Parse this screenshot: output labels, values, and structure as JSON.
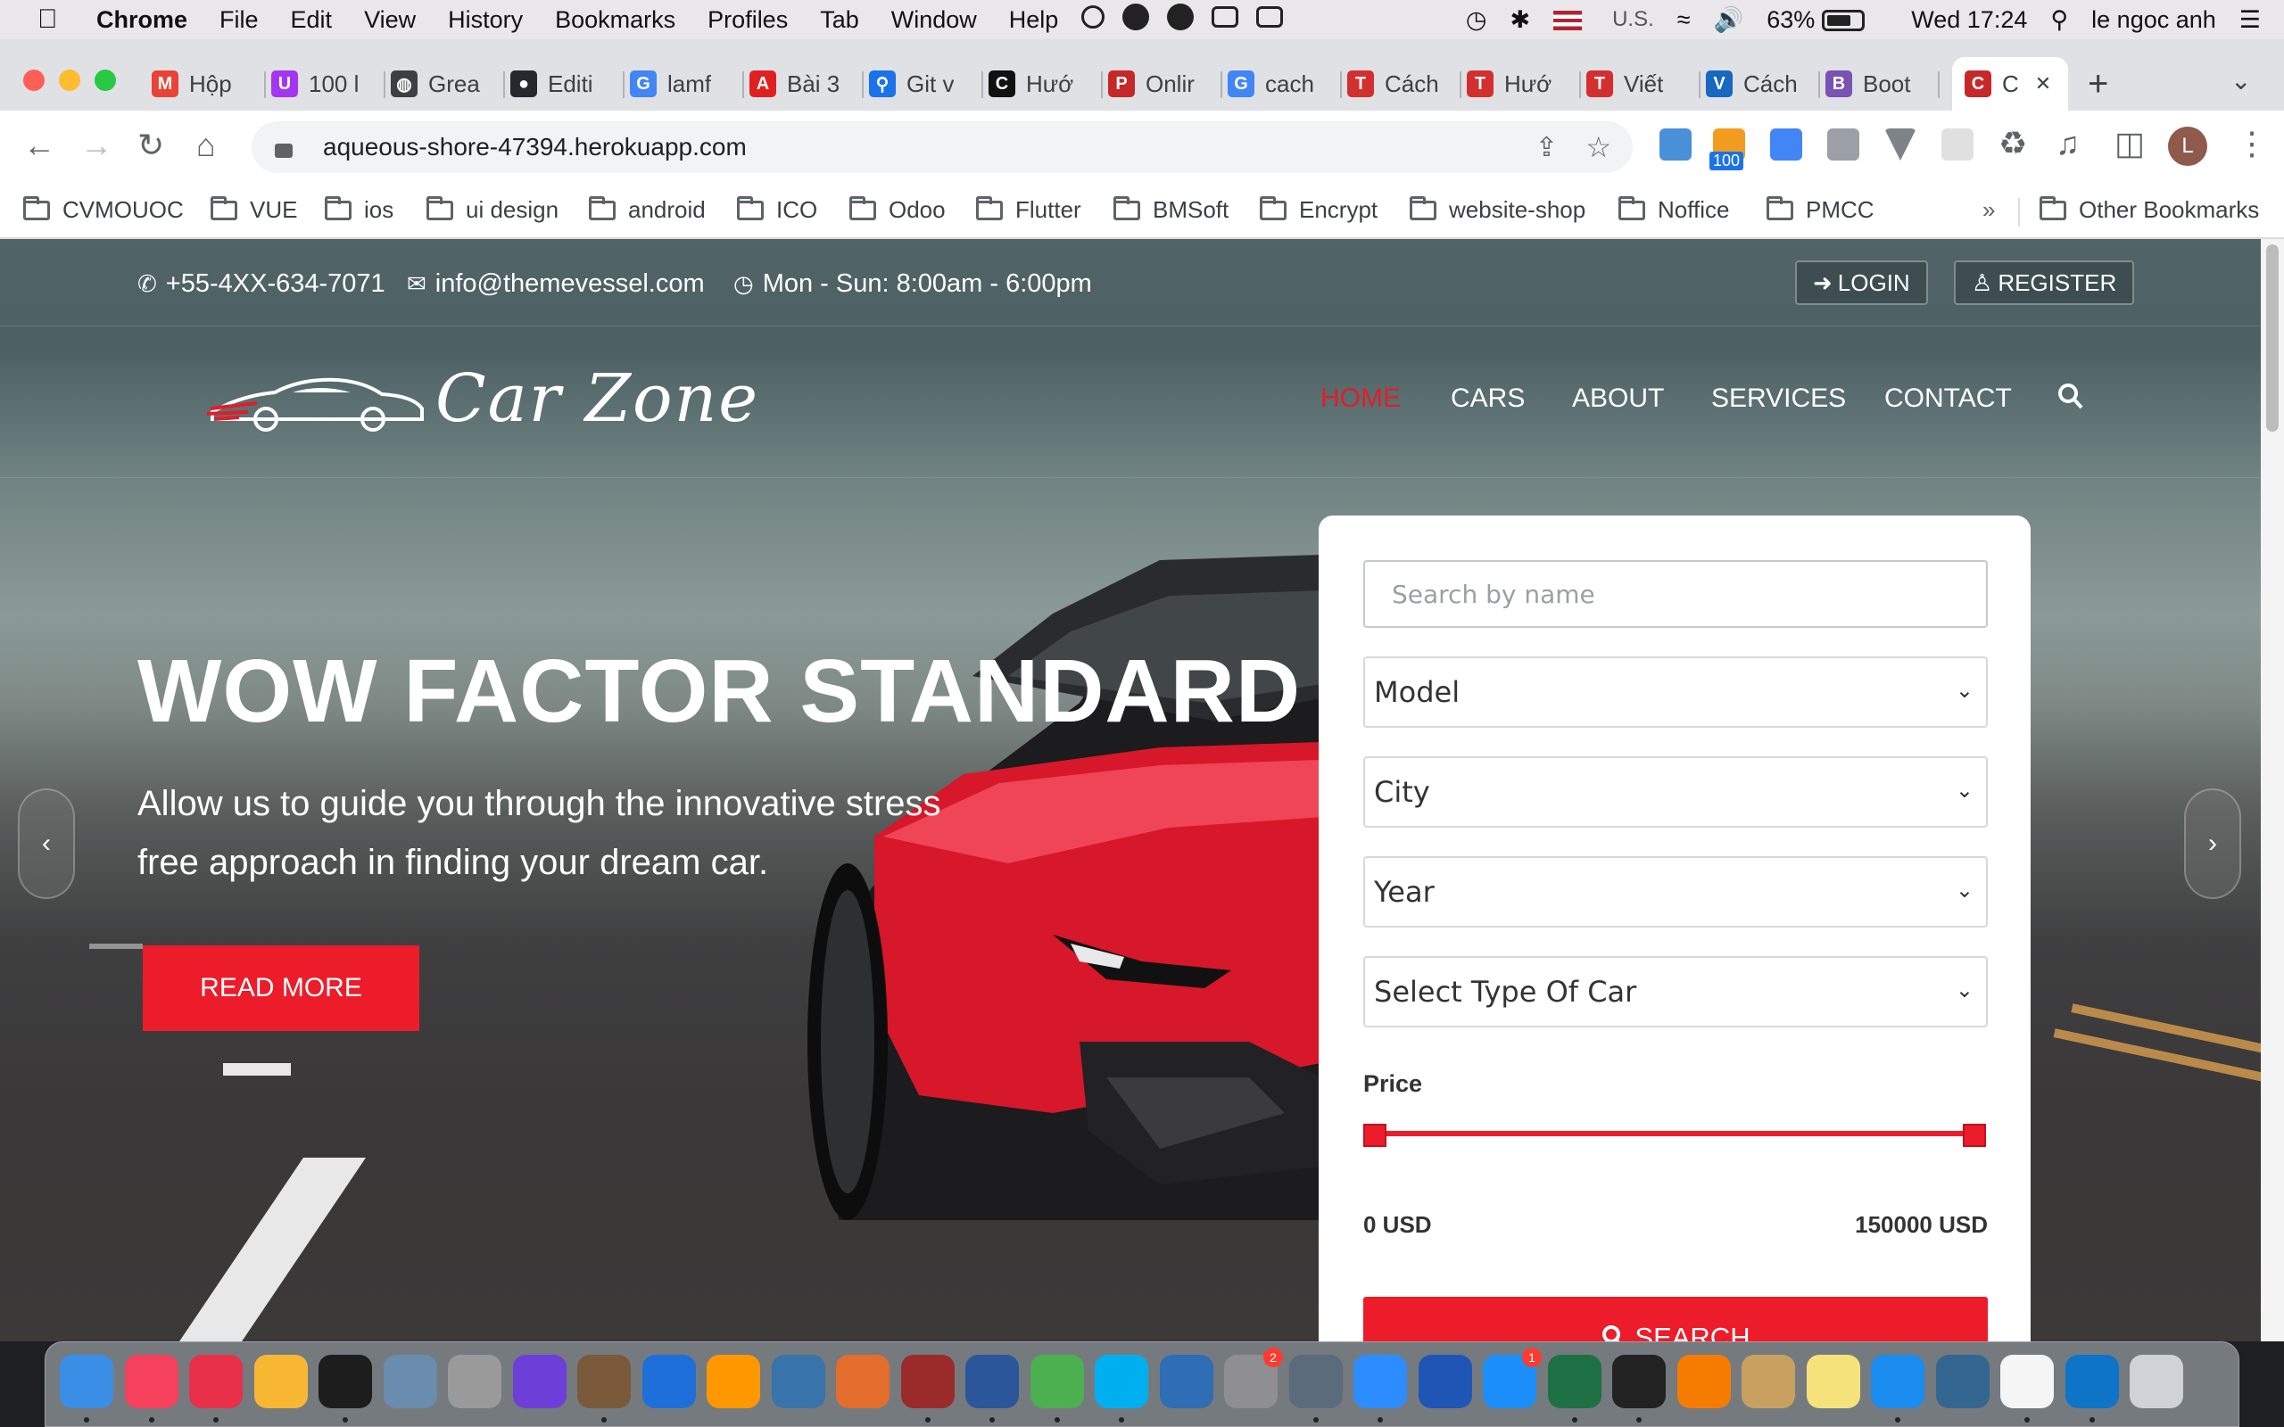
{
  "menubar": {
    "app": "Chrome",
    "items": [
      "File",
      "Edit",
      "View",
      "History",
      "Bookmarks",
      "Profiles",
      "Tab",
      "Window",
      "Help"
    ],
    "input_source": "U.S.",
    "battery": "63%",
    "clock": "Wed 17:24",
    "user": "le ngoc anh"
  },
  "tabs": [
    {
      "title": "Hộp",
      "icon": "gmail-icon",
      "color": "#ea4335",
      "glyph": "M"
    },
    {
      "title": "100 l",
      "icon": "udemy-icon",
      "color": "#a435f0",
      "glyph": "U"
    },
    {
      "title": "Grea",
      "icon": "globe-icon",
      "color": "#3c4043",
      "glyph": "◍"
    },
    {
      "title": "Editi",
      "icon": "github-icon",
      "color": "#24292e",
      "glyph": "●"
    },
    {
      "title": "lamf",
      "icon": "google-icon",
      "color": "#4285f4",
      "glyph": "G"
    },
    {
      "title": "Bài 3",
      "icon": "pdf-icon",
      "color": "#e02020",
      "glyph": "A"
    },
    {
      "title": "Git v",
      "icon": "location-icon",
      "color": "#1a73e8",
      "glyph": "⚲"
    },
    {
      "title": "Hướ",
      "icon": "c-icon",
      "color": "#111111",
      "glyph": "C"
    },
    {
      "title": "Onlir",
      "icon": "pdf-icon",
      "color": "#c62828",
      "glyph": "P"
    },
    {
      "title": "cach",
      "icon": "google-icon",
      "color": "#4285f4",
      "glyph": "G"
    },
    {
      "title": "Cách",
      "icon": "t-icon",
      "color": "#d32f2f",
      "glyph": "T"
    },
    {
      "title": "Hướ",
      "icon": "t-icon",
      "color": "#d32f2f",
      "glyph": "T"
    },
    {
      "title": "Viết",
      "icon": "t-icon",
      "color": "#d32f2f",
      "glyph": "T"
    },
    {
      "title": "Cách",
      "icon": "vuetify-icon",
      "color": "#1867c0",
      "glyph": "V"
    },
    {
      "title": "Boot",
      "icon": "bootstrap-icon",
      "color": "#7952b3",
      "glyph": "B"
    },
    {
      "title": "C",
      "icon": "carzone-icon",
      "color": "#c62828",
      "glyph": "C",
      "active": true
    }
  ],
  "toolbar": {
    "url": "aqueous-shore-47394.herokuapp.com",
    "ext_badge": "100",
    "avatar_letter": "L"
  },
  "bookmarks": [
    "CVMOUOC",
    "VUE",
    "ios",
    "ui design",
    "android",
    "ICO",
    "Odoo",
    "Flutter",
    "BMSoft",
    "Encrypt",
    "website-shop",
    "Noffice",
    "PMCC"
  ],
  "bookmarks_overflow": "»",
  "other_bookmarks": "Other Bookmarks",
  "site": {
    "phone": "+55-4XX-634-7071",
    "email": "info@themevessel.com",
    "hours": "Mon - Sun: 8:00am - 6:00pm",
    "login": "LOGIN",
    "register": "REGISTER",
    "logo": "Car Zone",
    "nav": [
      "HOME",
      "CARS",
      "ABOUT",
      "SERVICES",
      "CONTACT"
    ],
    "hero_title": "WOW FACTOR STANDARD",
    "hero_subtitle": "Allow us to guide you through the innovative stress free approach in finding your dream car.",
    "read_more": "READ MORE",
    "search": {
      "name_placeholder": "Search by name",
      "model": "Model",
      "city": "City",
      "year": "Year",
      "type": "Select Type Of Car",
      "price_label": "Price",
      "price_min": "0 USD",
      "price_max": "150000 USD",
      "button": "SEARCH"
    }
  },
  "dock_apps": [
    "Finder",
    "Music",
    "Creative Cloud",
    "Photos",
    "PyCharm",
    "Preview",
    "Automator",
    "iMovie",
    "Trackball",
    "QuickTime",
    "Sublime Text",
    "Python Launcher",
    "Sourcetree",
    "Dictionary",
    "Word",
    "Chrome",
    "Skype",
    "Network",
    "System Preferences",
    "Launchpad",
    "Zoom",
    "WD",
    "App Store",
    "Excel",
    "Terminal",
    "VLC",
    "Archive Utility",
    "Notes",
    "Safari",
    "pgAdmin",
    "TextEdit",
    "VS Code",
    "Trash"
  ],
  "dock_badges": {
    "system_preferences": "2",
    "app_store": "1"
  }
}
